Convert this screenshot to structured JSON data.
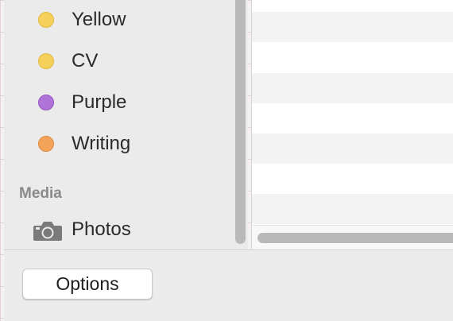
{
  "sidebar": {
    "tags": [
      {
        "label": "Yellow",
        "color": "#f5d15c",
        "border": "#e2b93d"
      },
      {
        "label": "CV",
        "color": "#f5d15c",
        "border": "#e2b93d"
      },
      {
        "label": "Purple",
        "color": "#b074d8",
        "border": "#9558bf"
      },
      {
        "label": "Writing",
        "color": "#f4a35a",
        "border": "#de8a3c"
      }
    ],
    "media_section_title": "Media",
    "media_items": [
      {
        "label": "Photos",
        "icon": "camera-icon"
      }
    ]
  },
  "footer": {
    "options_label": "Options"
  },
  "colors": {
    "sidebar_background": "#ebebeb",
    "scrollbar_thumb": "#b9b9b9",
    "stripe": "#f3f3f3"
  }
}
